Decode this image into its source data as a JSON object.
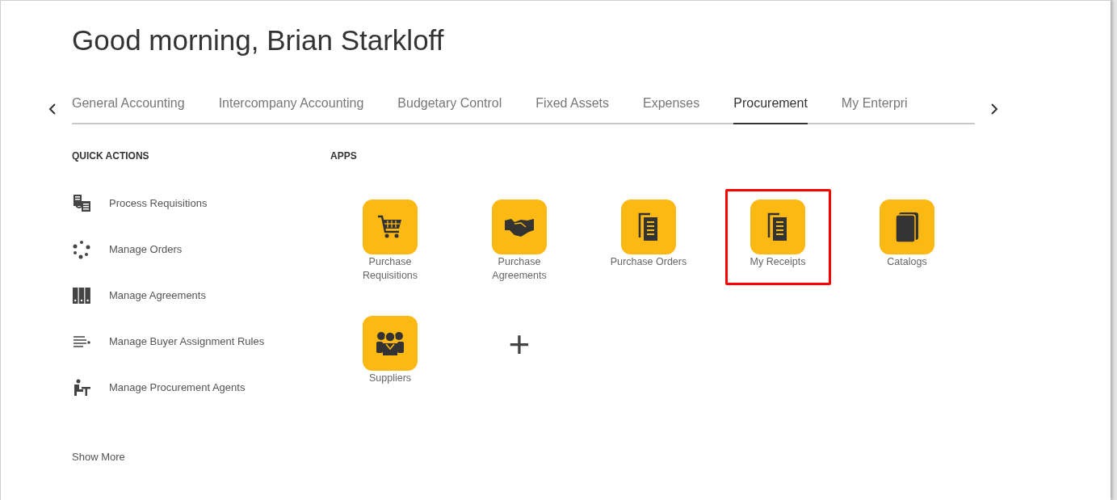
{
  "greeting": "Good morning, Brian Starkloff",
  "tabs": [
    {
      "label": "General Accounting",
      "selected": false
    },
    {
      "label": "Intercompany Accounting",
      "selected": false
    },
    {
      "label": "Budgetary Control",
      "selected": false
    },
    {
      "label": "Fixed Assets",
      "selected": false
    },
    {
      "label": "Expenses",
      "selected": false
    },
    {
      "label": "Procurement",
      "selected": true
    },
    {
      "label": "My Enterpri",
      "selected": false
    }
  ],
  "quick_actions": {
    "title": "QUICK ACTIONS",
    "items": [
      {
        "label": "Process Requisitions",
        "kind": "requisitions"
      },
      {
        "label": "Manage Orders",
        "kind": "orders"
      },
      {
        "label": "Manage Agreements",
        "kind": "agreements"
      },
      {
        "label": "Manage Buyer Assignment Rules",
        "kind": "rules"
      },
      {
        "label": "Manage Procurement Agents",
        "kind": "agents"
      }
    ],
    "show_more": "Show More"
  },
  "apps": {
    "title": "APPS",
    "items": [
      {
        "label": "Purchase Requisitions",
        "kind": "cart",
        "highlighted": false
      },
      {
        "label": "Purchase Agreements",
        "kind": "handshake",
        "highlighted": false
      },
      {
        "label": "Purchase Orders",
        "kind": "document",
        "highlighted": false
      },
      {
        "label": "My Receipts",
        "kind": "document",
        "highlighted": true
      },
      {
        "label": "Catalogs",
        "kind": "book",
        "highlighted": false
      },
      {
        "label": "Suppliers",
        "kind": "people",
        "highlighted": false
      }
    ],
    "add_button": "+"
  }
}
